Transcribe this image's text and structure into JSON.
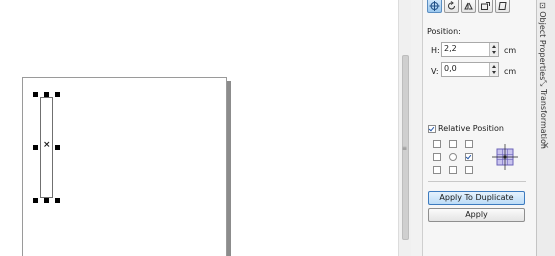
{
  "docker": {
    "position_label": "Position:",
    "h_label": "H:",
    "h_value": "2,2",
    "v_label": "V:",
    "v_value": "0,0",
    "unit": "cm",
    "relative_position_label": "Relative Position",
    "relative_position_checked": true,
    "apply_duplicate_label": "Apply To Duplicate",
    "apply_label": "Apply"
  },
  "side_tabs": {
    "object_properties": "Object Properties",
    "transformation": "Transformation"
  },
  "colors": {
    "accent": "#3d7bbf",
    "active_tool": "#9cc8ef"
  }
}
